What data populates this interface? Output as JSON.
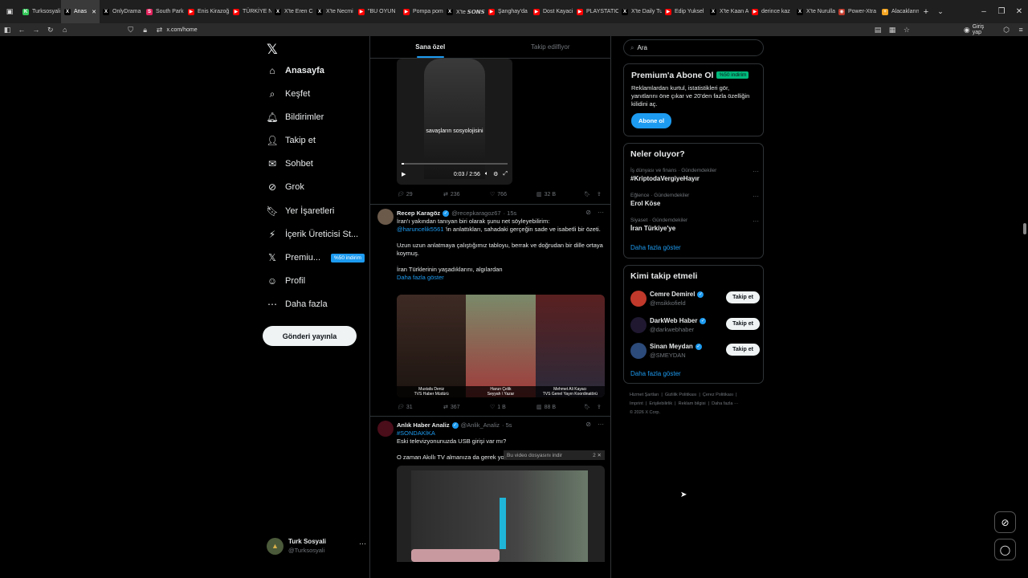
{
  "browser": {
    "tabs": [
      {
        "label": "Turksosyali",
        "color": "#34c759",
        "glyph": "K"
      },
      {
        "label": "Anas",
        "color": "#000000",
        "glyph": "X",
        "active": true
      },
      {
        "label": "OnlyDrama",
        "color": "#000000",
        "glyph": "X"
      },
      {
        "label": "South Park",
        "color": "#e0245e",
        "glyph": "S"
      },
      {
        "label": "Enis Kirazoğ",
        "color": "#ff0000",
        "glyph": "▶"
      },
      {
        "label": "TÜRKİYE NA",
        "color": "#ff0000",
        "glyph": "▶"
      },
      {
        "label": "X'te Eren Ca",
        "color": "#000000",
        "glyph": "X"
      },
      {
        "label": "X'te Necmi",
        "color": "#000000",
        "glyph": "X"
      },
      {
        "label": "\"BU OYUN",
        "color": "#ff0000",
        "glyph": "▶"
      },
      {
        "label": "Pompa pom",
        "color": "#ff0000",
        "glyph": "▶"
      },
      {
        "label": "X'te 𝙎𝙊𝙉𝙎",
        "color": "#000000",
        "glyph": "X"
      },
      {
        "label": "Şanghay'da",
        "color": "#ff0000",
        "glyph": "▶"
      },
      {
        "label": "Dost Kayaci",
        "color": "#ff0000",
        "glyph": "▶"
      },
      {
        "label": "PLAYSTATIC",
        "color": "#ff0000",
        "glyph": "▶"
      },
      {
        "label": "X'te Daily Tu",
        "color": "#000000",
        "glyph": "X"
      },
      {
        "label": "Edip Yuksel",
        "color": "#ff0000",
        "glyph": "▶"
      },
      {
        "label": "X'te Kaan A",
        "color": "#000000",
        "glyph": "X"
      },
      {
        "label": "derince kaz",
        "color": "#ff0000",
        "glyph": "▶"
      },
      {
        "label": "X'te Nurulla",
        "color": "#000000",
        "glyph": "X"
      },
      {
        "label": "Power-Xtra",
        "color": "#c0392b",
        "glyph": "◉"
      },
      {
        "label": "Alacaklarını",
        "color": "#f5a623",
        "glyph": "+"
      }
    ],
    "url": "x.com/home",
    "signin_label": "Giriş yap"
  },
  "nav": {
    "logo": "𝕏",
    "items": [
      {
        "label": "Anasayfa",
        "icon": "home-icon",
        "glyph": "⌂"
      },
      {
        "label": "Keşfet",
        "icon": "search-icon",
        "glyph": "⌕"
      },
      {
        "label": "Bildirimler",
        "icon": "bell-icon",
        "glyph": "🔔︎"
      },
      {
        "label": "Takip et",
        "icon": "add-person-icon",
        "glyph": "👤︎"
      },
      {
        "label": "Sohbet",
        "icon": "mail-icon",
        "glyph": "✉"
      },
      {
        "label": "Grok",
        "icon": "grok-icon",
        "glyph": "⊘"
      },
      {
        "label": "Yer İşaretleri",
        "icon": "bookmark-icon",
        "glyph": "🔖︎"
      },
      {
        "label": "İçerik Üreticisi St...",
        "icon": "lightning-icon",
        "glyph": "⚡︎"
      },
      {
        "label": "Premiu...",
        "icon": "x-premium-icon",
        "glyph": "𝕏"
      },
      {
        "label": "Profil",
        "icon": "profile-icon",
        "glyph": "☺"
      },
      {
        "label": "Daha fazla",
        "icon": "more-circle-icon",
        "glyph": "⋯"
      }
    ],
    "premium_badge": "%50 indirim",
    "post_button": "Gönderi yayınla",
    "account": {
      "name": "Turk Sosyali",
      "handle": "@Turksosyali",
      "menu": "···"
    }
  },
  "feed": {
    "tabs": [
      "Sana özel",
      "Takip edilfiyor"
    ],
    "video1": {
      "caption": "savaşların sosyolojisini",
      "time": "0:03 / 2:56",
      "progress": 0.02
    },
    "actions1": {
      "reply": "29",
      "repost": "236",
      "like": "766",
      "views": "32 B"
    },
    "tweet2": {
      "name": "Recep Karagöz",
      "handle": "@recepkaragoz67",
      "time": "· 15s",
      "text1": "İran'ı yakından tanıyan biri olarak şunu net söyleyebilirim:",
      "mention": "@haruncelik5561",
      "text2": "'in anlattıkları, sahadaki gerçeğin sade ve isabetli bir özeti.",
      "text3": "Uzun uzun anlatmaya çalıştığımız tabloyu, berrak ve doğrudan bir dille ortaya koymuş.",
      "text4": "İran Türklerinin yaşadıklarını, algılardan",
      "show_more": "Daha fazla göster",
      "panels": [
        {
          "label": "Mustafa Deniz\nTVS Haber Müdürü"
        },
        {
          "label": "Harun Çelik\nSeyyah \\ Yazar"
        },
        {
          "label": "Mehmet Ali Kayacı\nTVS Genel Yayın Koordinatörü"
        }
      ],
      "actions": {
        "reply": "31",
        "repost": "367",
        "like": "1 B",
        "views": "88 B"
      }
    },
    "tweet3": {
      "name": "Anlık Haber Analiz",
      "handle": "@Anlik_Analiz",
      "time": "· 5s",
      "hashtag": "#SONDAKİKA",
      "text1": "Eski televizyonunuzda USB girişi var mı?",
      "text2": "O zaman Akıllı TV almanıza da gerek yok",
      "download_bar": "Bu video dosyasını indir",
      "download_count": "2"
    }
  },
  "right": {
    "search_placeholder": "Ara",
    "premium": {
      "title": "Premium'a Abone Ol",
      "tag": "%50 indirim",
      "text": "Reklamlardan kurtul, istatistikleri gör, yanıtlarını öne çıkar ve 20'den fazla özelliğin kilidini aç.",
      "button": "Abone ol"
    },
    "trends": {
      "title": "Neler oluyor?",
      "items": [
        {
          "category": "İş dünyası ve finans · Gündemdekiler",
          "name": "#KriptodaVergiyeHayır"
        },
        {
          "category": "Eğlence · Gündemdekiler",
          "name": "Erol Köse"
        },
        {
          "category": "Siyaset · Gündemdekiler",
          "name": "İran Türkiye'ye"
        }
      ],
      "show_more": "Daha fazla göster"
    },
    "who": {
      "title": "Kimi takip etmeli",
      "items": [
        {
          "name": "Cemre Demirel",
          "handle": "@msikkofield",
          "color": "#c0392b"
        },
        {
          "name": "DarkWeb Haber",
          "handle": "@darkwebhaber",
          "color": "#1f1830"
        },
        {
          "name": "Sinan Meydan",
          "handle": "@SMEYDAN",
          "color": "#2c4a7a"
        }
      ],
      "follow": "Takip et",
      "show_more": "Daha fazla göster"
    },
    "footer": [
      "Hizmet Şartları",
      "Gizlilik Politikası",
      "Çerez Politikası",
      "Imprint",
      "Erişilebilirlik",
      "Reklam bilgisi",
      "Daha fazla ···",
      "© 2026 X Corp."
    ]
  }
}
